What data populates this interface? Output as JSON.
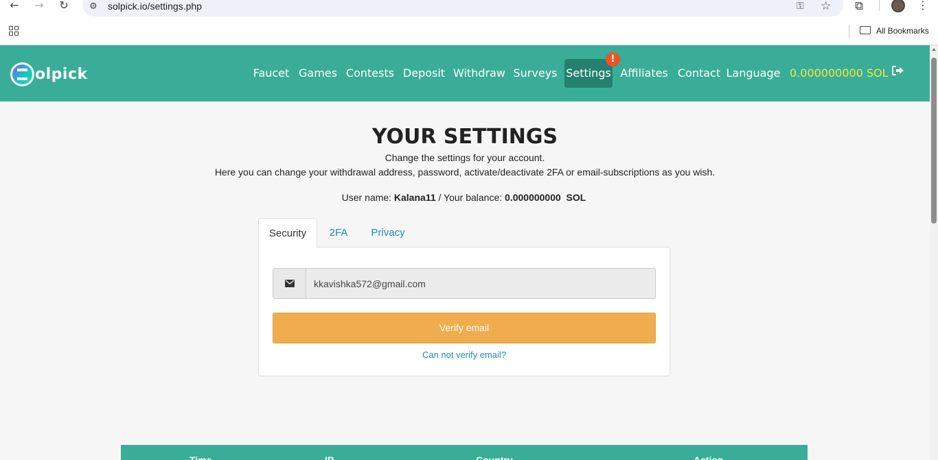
{
  "browser": {
    "url": "solpick.io/settings.php",
    "bookmarks_label": "All Bookmarks"
  },
  "nav": {
    "logo_text": "olpick",
    "items": [
      {
        "label": "Faucet"
      },
      {
        "label": "Games"
      },
      {
        "label": "Contests"
      },
      {
        "label": "Deposit"
      },
      {
        "label": "Withdraw"
      },
      {
        "label": "Surveys"
      },
      {
        "label": "Settings"
      },
      {
        "label": "Affiliates"
      },
      {
        "label": "Contact"
      },
      {
        "label": "Language"
      }
    ],
    "active_item": "Settings",
    "badge": "!",
    "balance": "0.000000000 SOL",
    "colors": {
      "bar": "#39ad98",
      "active": "#24816f",
      "balance": "#f5e93a",
      "badge": "#ee5325"
    }
  },
  "page": {
    "title": "YOUR SETTINGS",
    "subtitle1": "Change the settings for your account.",
    "subtitle2": "Here you can change your withdrawal address, password, activate/deactivate 2FA or email-subscriptions as you wish.",
    "user_prefix": "User name:",
    "username": "Kalana11",
    "balance_prefix": "/ Your balance:",
    "balance": "0.000000000  SOL"
  },
  "tabs": [
    {
      "label": "Security",
      "active": true
    },
    {
      "label": "2FA",
      "active": false
    },
    {
      "label": "Privacy",
      "active": false
    }
  ],
  "security": {
    "email_value": "kkavishka572@gmail.com",
    "verify_label": "Verify email",
    "help_link": "Can not verify email?",
    "button_color": "#f0ad4e"
  },
  "table": {
    "headers": [
      "Time",
      "IP",
      "Country",
      "Action"
    ]
  }
}
